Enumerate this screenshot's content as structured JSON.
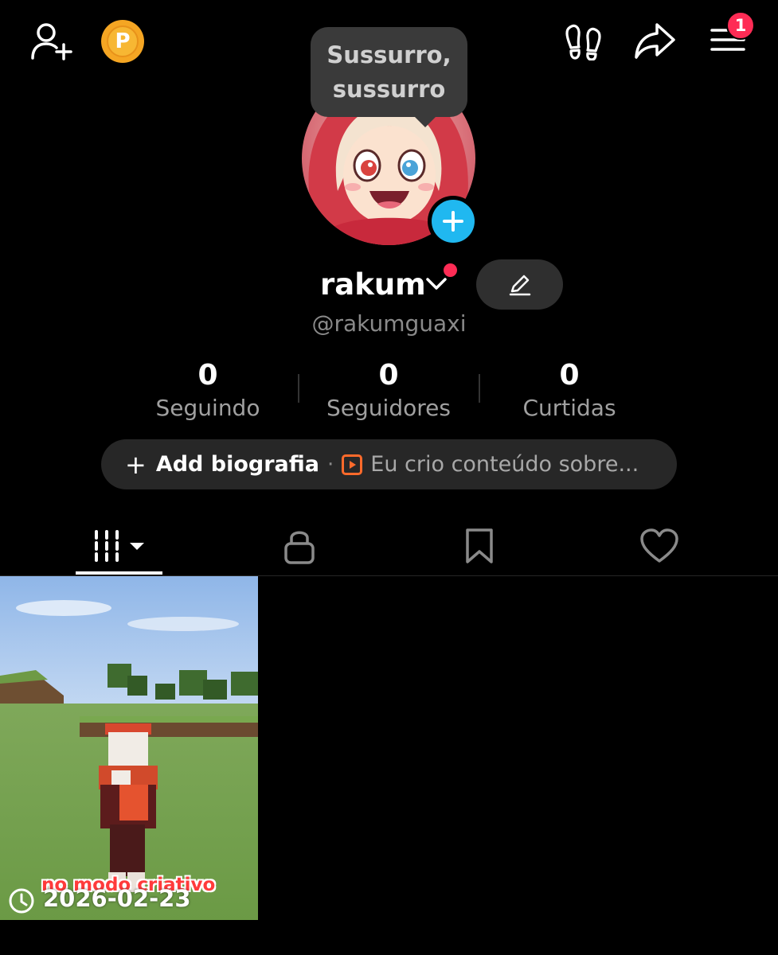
{
  "header": {
    "add_friend_icon": "person-plus-icon",
    "coin_label": "P",
    "footprints_icon": "footprints-icon",
    "share_icon": "share-arrow-icon",
    "menu_icon": "hamburger-menu-icon",
    "menu_badge": "1"
  },
  "tooltip": {
    "line1": "Sussurro,",
    "line2": "sussurro"
  },
  "profile": {
    "username": "rakum",
    "handle": "@rakumguaxi"
  },
  "stats": [
    {
      "value": "0",
      "label": "Seguindo"
    },
    {
      "value": "0",
      "label": "Seguidores"
    },
    {
      "value": "0",
      "label": "Curtidas"
    }
  ],
  "bio": {
    "add_label": "Add biografia",
    "separator": "·",
    "suggestion": "Eu crio conteúdo sobre..."
  },
  "tabs": [
    {
      "name": "videos",
      "icon": "grid-icon",
      "active": true
    },
    {
      "name": "private",
      "icon": "lock-icon",
      "active": false
    },
    {
      "name": "saved",
      "icon": "bookmark-icon",
      "active": false
    },
    {
      "name": "liked",
      "icon": "heart-icon",
      "active": false
    }
  ],
  "videos": [
    {
      "caption": "no modo criativo",
      "date": "2026-02-23"
    }
  ],
  "colors": {
    "background": "#000000",
    "accent_red": "#fe2c55",
    "accent_blue": "#20b8f0",
    "coin": "#f5a623",
    "pill": "#272727"
  }
}
